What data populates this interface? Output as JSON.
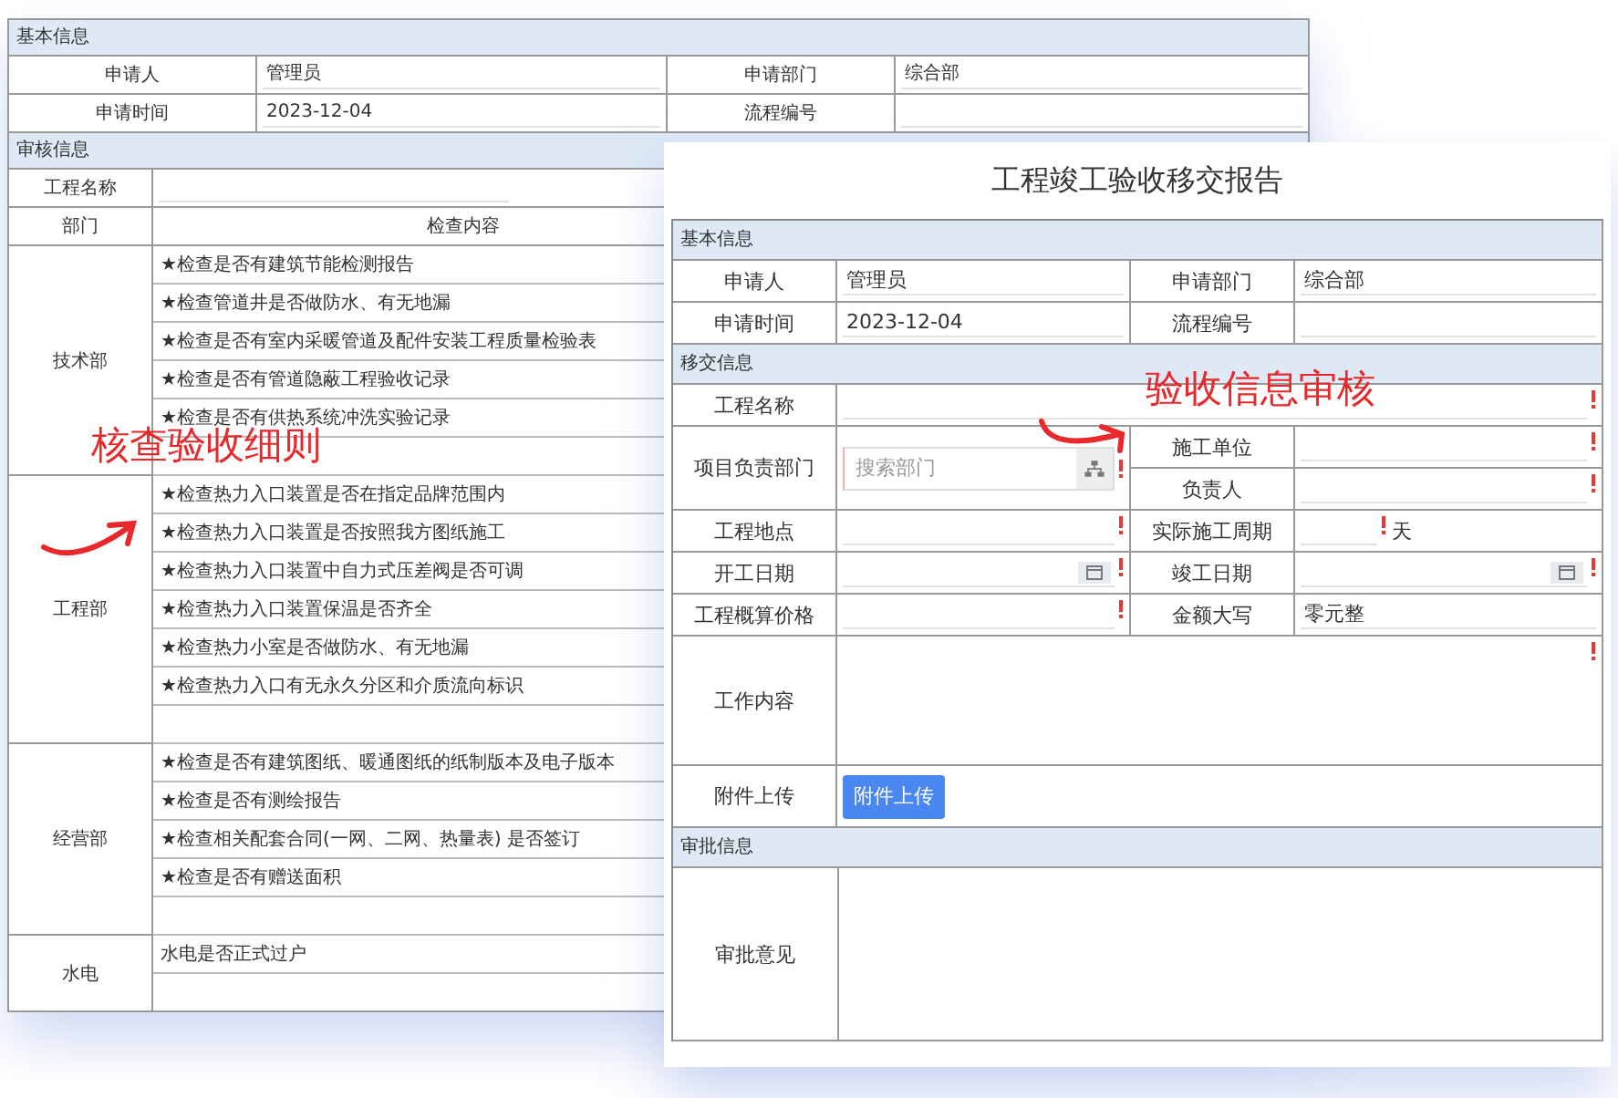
{
  "back_form": {
    "basic_info": {
      "title": "基本信息",
      "fields": [
        {
          "label": "申请人",
          "value": "管理员"
        },
        {
          "label": "申请部门",
          "value": "综合部"
        },
        {
          "label": "申请时间",
          "value": "2023-12-04"
        },
        {
          "label": "流程编号"
        }
      ]
    },
    "review": {
      "title": "审核信息",
      "project_name_label": "工程名称",
      "columns": [
        "部门",
        "检查内容"
      ],
      "groups": [
        {
          "department": "技术部",
          "items": [
            "★检查是否有建筑节能检测报告",
            "★检查管道井是否做防水、有无地漏",
            "★检查是否有室内采暖管道及配件安装工程质量检验表",
            "★检查是否有管道隐蔽工程验收记录",
            "★检查是否有供热系统冲洗实验记录"
          ]
        },
        {
          "department": "工程部",
          "items": [
            "★检查热力入口装置是否在指定品牌范围内",
            "★检查热力入口装置是否按照我方图纸施工",
            "★检查热力入口装置中自力式压差阀是否可调",
            "★检查热力入口装置保温是否齐全",
            "★检查热力小室是否做防水、有无地漏",
            "★检查热力入口有无永久分区和介质流向标识"
          ]
        },
        {
          "department": "经营部",
          "items": [
            "★检查是否有建筑图纸、暖通图纸的纸制版本及电子版本",
            "★检查是否有测绘报告",
            "★检查相关配套合同(一网、二网、热量表) 是否签订",
            "★检查是否有赠送面积"
          ]
        },
        {
          "department": "水电",
          "items": [
            "水电是否正式过户"
          ]
        }
      ]
    }
  },
  "front_form": {
    "title": "工程竣工验收移交报告",
    "basic_info": {
      "title": "基本信息",
      "fields": [
        {
          "label": "申请人",
          "value": "管理员"
        },
        {
          "label": "申请部门",
          "value": "综合部"
        },
        {
          "label": "申请时间",
          "value": "2023-12-04"
        },
        {
          "label": "流程编号"
        }
      ]
    },
    "handover": {
      "title": "移交信息",
      "fields": [
        {
          "label": "工程名称",
          "kind": "wide",
          "required": true
        },
        {
          "label": "项目负责部门",
          "kind": "search",
          "placeholder": "搜索部门",
          "required": true
        },
        {
          "label": "施工单位",
          "kind": "text",
          "required": true
        },
        {
          "label": "负责人",
          "kind": "text",
          "required": true
        },
        {
          "label": "工程地点",
          "kind": "text",
          "required": true
        },
        {
          "label": "实际施工周期",
          "kind": "days",
          "unit": "天",
          "required": true
        },
        {
          "label": "开工日期",
          "kind": "date",
          "required": true
        },
        {
          "label": "竣工日期",
          "kind": "date",
          "required": true
        },
        {
          "label": "工程概算价格",
          "kind": "text",
          "required": true
        },
        {
          "label": "金额大写",
          "kind": "text",
          "value": "零元整",
          "required": false
        },
        {
          "label": "工作内容",
          "kind": "textarea",
          "required": true
        },
        {
          "label": "附件上传",
          "kind": "upload",
          "button": "附件上传",
          "required": false
        }
      ]
    },
    "approval": {
      "title": "审批信息",
      "label": "审批意见"
    }
  },
  "annotations": [
    {
      "text": "核查验收细则"
    },
    {
      "text": "验收信息审核"
    }
  ]
}
